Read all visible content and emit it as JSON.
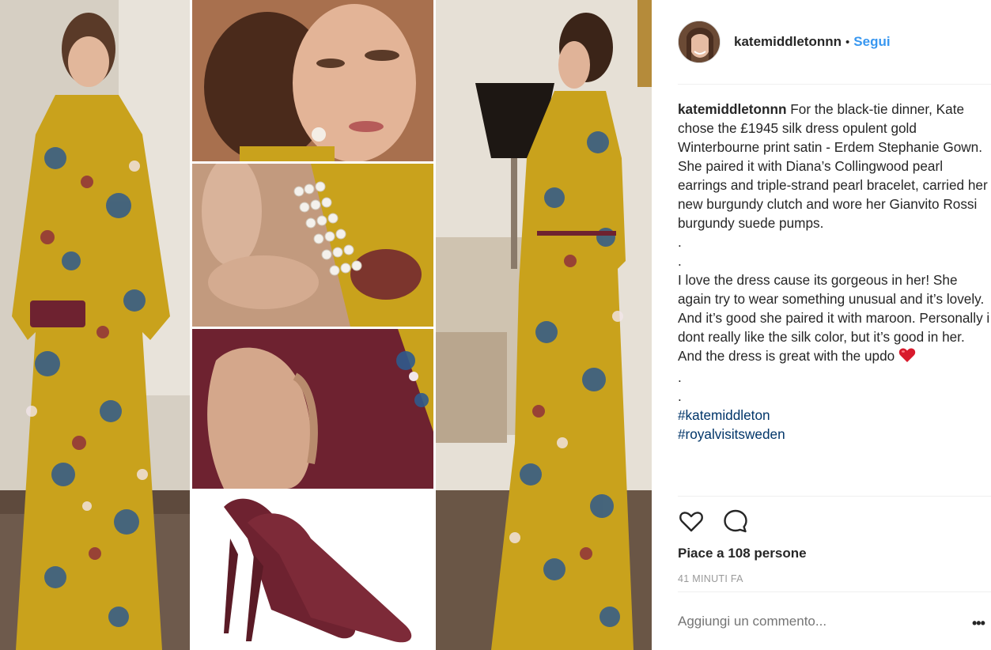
{
  "post": {
    "username": "katemiddletonnn",
    "separator": "•",
    "follow_label": "Segui",
    "caption": {
      "username": "katemiddletonnn",
      "text_1": "For the black-tie dinner, Kate chose the £1945 silk dress opulent gold Winterbourne print satin - Erdem Stephanie Gown. She paired it with Diana’s Collingwood pearl earrings and triple-strand pearl bracelet, carried her new burgundy clutch and wore her Gianvito Rossi burgundy suede pumps.",
      "dot_1": ".",
      "dot_2": ".",
      "text_2": "I love the dress cause its gorgeous in her! She again try to wear something unusual and it’s lovely. And it’s good she paired it with maroon. Personally i dont really like the silk color, but it’s good in her. And the dress is great with the updo",
      "dot_3": ".",
      "dot_4": ".",
      "hashtags": [
        "#katemiddleton",
        "#royalvisitsweden"
      ]
    },
    "likes": "Piace a 108 persone",
    "time": "41 MINUTI FA",
    "comment_placeholder": "Aggiungi un commento...",
    "more_label": "•••"
  },
  "icons": {
    "like": "heart-outline-icon",
    "comment": "speech-bubble-icon",
    "emoji": "red-heart-emoji",
    "more": "ellipsis-icon"
  },
  "colors": {
    "link": "#3897f0",
    "hashtag": "#003569",
    "muted": "#999999",
    "dress_gold": "#c9a21c",
    "burgundy": "#6e2230"
  }
}
